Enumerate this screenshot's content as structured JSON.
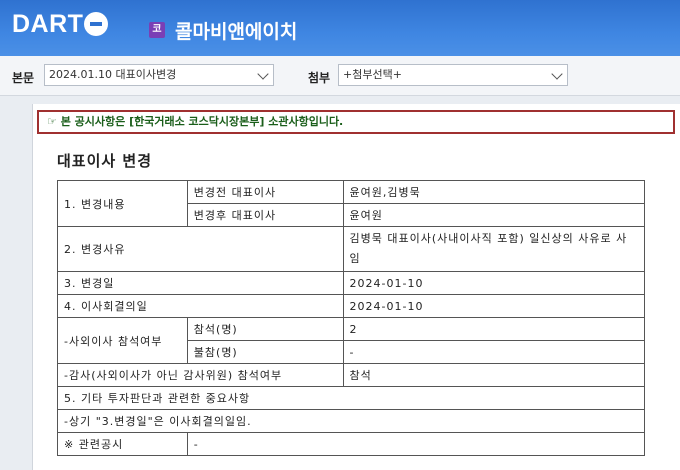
{
  "header": {
    "logo": "DART",
    "company_badge": "코",
    "company_name": "콜마비앤에이치"
  },
  "toolbar": {
    "main_label": "본문",
    "main_value": "2024.01.10 대표이사변경",
    "attach_label": "첨부",
    "attach_value": "+첨부선택+"
  },
  "notice": "☞ 본 공시사항은 [한국거래소 코스닥시장본부] 소관사항입니다.",
  "doc_title": "대표이사 변경",
  "table": {
    "r1_label": "1. 변경내용",
    "r1_before": "변경전 대표이사",
    "r1_before_val": "윤여원,김병묵",
    "r1_after": "변경후 대표이사",
    "r1_after_val": "윤여원",
    "r2_label": "2. 변경사유",
    "r2_val": "김병묵 대표이사(사내이사직 포함) 일신상의 사유로 사임",
    "r3_label": "3. 변경일",
    "r3_val": "2024-01-10",
    "r4_label": "4. 이사회결의일",
    "r4_val": "2024-01-10",
    "r5_label": "-사외이사 참석여부",
    "r5_present": "참석(명)",
    "r5_present_val": "2",
    "r5_absent": "불참(명)",
    "r5_absent_val": "-",
    "r6_label": "-감사(사외이사가 아닌 감사위원) 참석여부",
    "r6_val": "참석",
    "r7_label": "5. 기타 투자판단과 관련한 중요사항",
    "r8_label": "-상기 \"3.변경일\"은 이사회결의일임.",
    "r9_label": "※ 관련공시",
    "r9_val": "-"
  }
}
